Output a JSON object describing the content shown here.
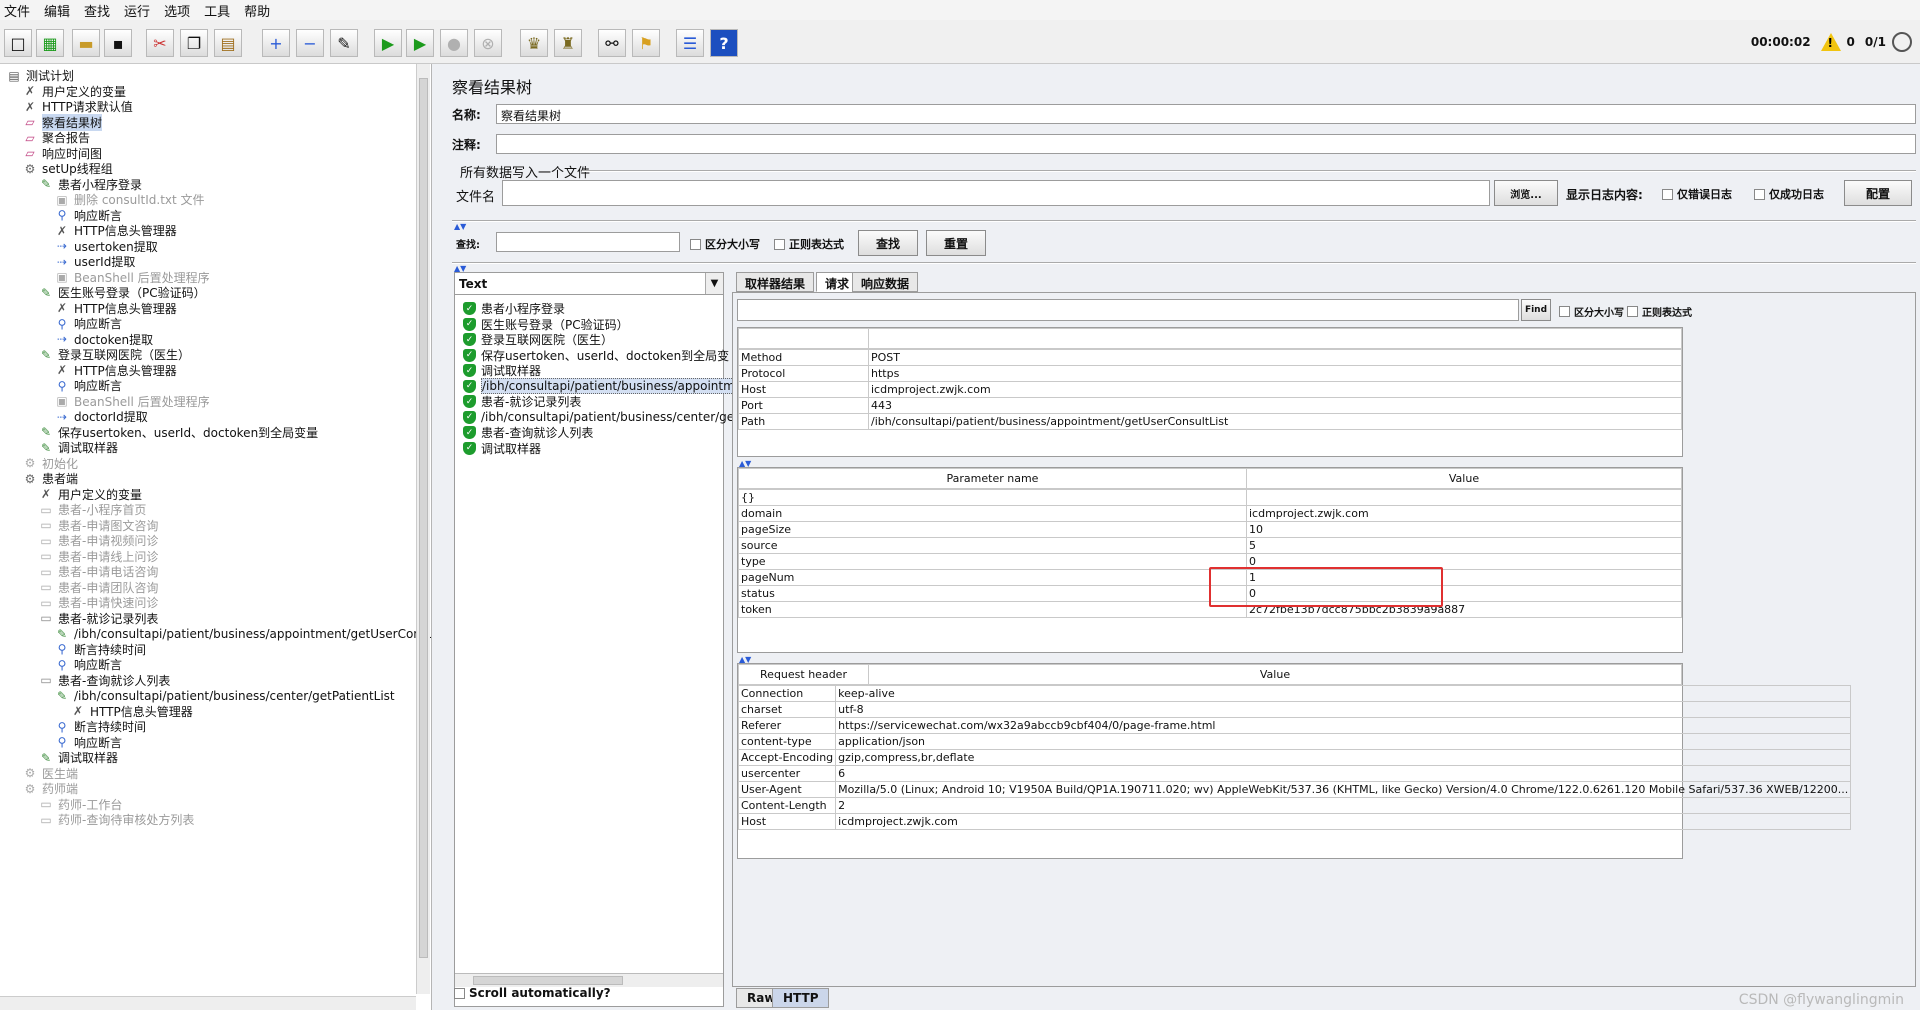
{
  "menu": [
    "文件",
    "编辑",
    "查找",
    "运行",
    "选项",
    "工具",
    "帮助"
  ],
  "toolbar": {
    "timer": "00:00:02",
    "warn_count": "0",
    "threads": "0/1"
  },
  "tree": [
    {
      "label": "测试计划",
      "icon": "plan-icon",
      "indent": 0
    },
    {
      "label": "用户定义的变量",
      "icon": "wrench-icon",
      "indent": 1
    },
    {
      "label": "HTTP请求默认值",
      "icon": "wrench-icon",
      "indent": 1
    },
    {
      "label": "察看结果树",
      "icon": "chart-icon",
      "indent": 1,
      "selected": true
    },
    {
      "label": "聚合报告",
      "icon": "chart-icon",
      "indent": 1
    },
    {
      "label": "响应时间图",
      "icon": "chart-icon",
      "indent": 1
    },
    {
      "label": "setUp线程组",
      "icon": "gear-icon",
      "indent": 1
    },
    {
      "label": "患者小程序登录",
      "icon": "pipette-icon",
      "indent": 2
    },
    {
      "label": "删除 consultId.txt 文件",
      "icon": "script-icon",
      "indent": 3,
      "disabled": true
    },
    {
      "label": "响应断言",
      "icon": "magnifier-icon",
      "indent": 3
    },
    {
      "label": "HTTP信息头管理器",
      "icon": "wrench-icon",
      "indent": 3
    },
    {
      "label": "usertoken提取",
      "icon": "extract-icon",
      "indent": 3
    },
    {
      "label": "userId提取",
      "icon": "extract-icon",
      "indent": 3
    },
    {
      "label": "BeanShell 后置处理程序",
      "icon": "script-icon",
      "indent": 3,
      "disabled": true
    },
    {
      "label": "医生账号登录（PC验证码）",
      "icon": "pipette-icon",
      "indent": 2
    },
    {
      "label": "HTTP信息头管理器",
      "icon": "wrench-icon",
      "indent": 3
    },
    {
      "label": "响应断言",
      "icon": "magnifier-icon",
      "indent": 3
    },
    {
      "label": "doctoken提取",
      "icon": "extract-icon",
      "indent": 3
    },
    {
      "label": "登录互联网医院（医生）",
      "icon": "pipette-icon",
      "indent": 2
    },
    {
      "label": "HTTP信息头管理器",
      "icon": "wrench-icon",
      "indent": 3
    },
    {
      "label": "响应断言",
      "icon": "magnifier-icon",
      "indent": 3
    },
    {
      "label": "BeanShell 后置处理程序",
      "icon": "script-icon",
      "indent": 3,
      "disabled": true
    },
    {
      "label": "doctorId提取",
      "icon": "extract-icon",
      "indent": 3
    },
    {
      "label": "保存usertoken、userId、doctoken到全局变量",
      "icon": "pipette-icon",
      "indent": 2
    },
    {
      "label": "调试取样器",
      "icon": "pipette-icon",
      "indent": 2
    },
    {
      "label": "初始化",
      "icon": "gear-icon",
      "indent": 1,
      "disabled": true
    },
    {
      "label": "患者端",
      "icon": "gear-icon",
      "indent": 1
    },
    {
      "label": "用户定义的变量",
      "icon": "wrench-icon",
      "indent": 2
    },
    {
      "label": "患者-小程序首页",
      "icon": "folder-icon",
      "indent": 2,
      "disabled": true
    },
    {
      "label": "患者-申请图文咨询",
      "icon": "folder-icon",
      "indent": 2,
      "disabled": true
    },
    {
      "label": "患者-申请视频问诊",
      "icon": "folder-icon",
      "indent": 2,
      "disabled": true
    },
    {
      "label": "患者-申请线上问诊",
      "icon": "folder-icon",
      "indent": 2,
      "disabled": true
    },
    {
      "label": "患者-申请电话咨询",
      "icon": "folder-icon",
      "indent": 2,
      "disabled": true
    },
    {
      "label": "患者-申请团队咨询",
      "icon": "folder-icon",
      "indent": 2,
      "disabled": true
    },
    {
      "label": "患者-申请快速问诊",
      "icon": "folder-icon",
      "indent": 2,
      "disabled": true
    },
    {
      "label": "患者-就诊记录列表",
      "icon": "folder-icon",
      "indent": 2
    },
    {
      "label": "/ibh/consultapi/patient/business/appointment/getUserConsultL",
      "icon": "pipette-icon",
      "indent": 3
    },
    {
      "label": "断言持续时间",
      "icon": "magnifier-icon",
      "indent": 3
    },
    {
      "label": "响应断言",
      "icon": "magnifier-icon",
      "indent": 3
    },
    {
      "label": "患者-查询就诊人列表",
      "icon": "folder-icon",
      "indent": 2
    },
    {
      "label": "/ibh/consultapi/patient/business/center/getPatientList",
      "icon": "pipette-icon",
      "indent": 3
    },
    {
      "label": "HTTP信息头管理器",
      "icon": "wrench-icon",
      "indent": 4
    },
    {
      "label": "断言持续时间",
      "icon": "magnifier-icon",
      "indent": 3
    },
    {
      "label": "响应断言",
      "icon": "magnifier-icon",
      "indent": 3
    },
    {
      "label": "调试取样器",
      "icon": "pipette-icon",
      "indent": 2
    },
    {
      "label": "医生端",
      "icon": "gear-icon",
      "indent": 1,
      "disabled": true
    },
    {
      "label": "药师端",
      "icon": "gear-icon",
      "indent": 1,
      "disabled": true
    },
    {
      "label": "药师-工作台",
      "icon": "folder-icon",
      "indent": 2,
      "disabled": true
    },
    {
      "label": "药师-查询待审核处方列表",
      "icon": "folder-icon",
      "indent": 2,
      "disabled": true
    }
  ],
  "panel": {
    "title": "察看结果树",
    "name_label": "名称:",
    "name_value": "察看结果树",
    "comment_label": "注释:",
    "comment_value": "",
    "write_all_label": "所有数据写入一个文件",
    "filename_label": "文件名",
    "browse_button": "浏览...",
    "log_label": "显示日志内容:",
    "errors_only": "仅错误日志",
    "success_only": "仅成功日志",
    "configure_button": "配置",
    "search_label": "查找:",
    "case_sensitive": "区分大小写",
    "regex": "正则表达式",
    "search_button": "查找",
    "reset_button": "重置"
  },
  "results": {
    "renderer": "Text",
    "items": [
      "患者小程序登录",
      "医生账号登录（PC验证码）",
      "登录互联网医院（医生）",
      "保存usertoken、userId、doctoken到全局变",
      "调试取样器",
      "/ibh/consultapi/patient/business/appointm",
      "患者-就诊记录列表",
      "/ibh/consultapi/patient/business/center/ge",
      "患者-查询就诊人列表",
      "调试取样器"
    ],
    "selected_index": 5,
    "scroll_auto": "Scroll automatically?"
  },
  "detail": {
    "tabs": [
      "取样器结果",
      "请求",
      "响应数据"
    ],
    "active_tab": 1,
    "find_button": "Find",
    "find_case": "区分大小写",
    "find_regex": "正则表达式",
    "request_info": [
      [
        "Method",
        "POST"
      ],
      [
        "Protocol",
        "https"
      ],
      [
        "Host",
        "icdmproject.zwjk.com"
      ],
      [
        "Port",
        "443"
      ],
      [
        "Path",
        "/ibh/consultapi/patient/business/appointment/getUserConsultList"
      ]
    ],
    "params_headers": [
      "Parameter name",
      "Value"
    ],
    "params": [
      [
        "{}",
        ""
      ],
      [
        "domain",
        "icdmproject.zwjk.com"
      ],
      [
        "pageSize",
        "10"
      ],
      [
        "source",
        "5"
      ],
      [
        "type",
        "0"
      ],
      [
        "pageNum",
        "1"
      ],
      [
        "status",
        "0"
      ],
      [
        "token",
        "2c72fbe13b7dcc875bbc2b3839a9a887"
      ]
    ],
    "headers_headers": [
      "Request header",
      "Value"
    ],
    "headers": [
      [
        "Connection",
        "keep-alive"
      ],
      [
        "charset",
        "utf-8"
      ],
      [
        "Referer",
        "https://servicewechat.com/wx32a9abccb9cbf404/0/page-frame.html"
      ],
      [
        "content-type",
        "application/json"
      ],
      [
        "Accept-Encoding",
        "gzip,compress,br,deflate"
      ],
      [
        "usercenter",
        "6"
      ],
      [
        "User-Agent",
        "Mozilla/5.0 (Linux; Android 10; V1950A Build/QP1A.190711.020; wv) AppleWebKit/537.36 (KHTML, like Gecko) Version/4.0 Chrome/122.0.6261.120 Mobile Safari/537.36 XWEB/12200..."
      ],
      [
        "Content-Length",
        "2"
      ],
      [
        "Host",
        "icdmproject.zwjk.com"
      ]
    ],
    "bottom_tabs": [
      "Raw",
      "HTTP"
    ],
    "active_bottom_tab": 1
  },
  "watermark": "CSDN @flywanglingmin",
  "colors": {
    "highlight": "#e03030",
    "selection": "#c8d8f0",
    "success": "#1d9c2d"
  }
}
